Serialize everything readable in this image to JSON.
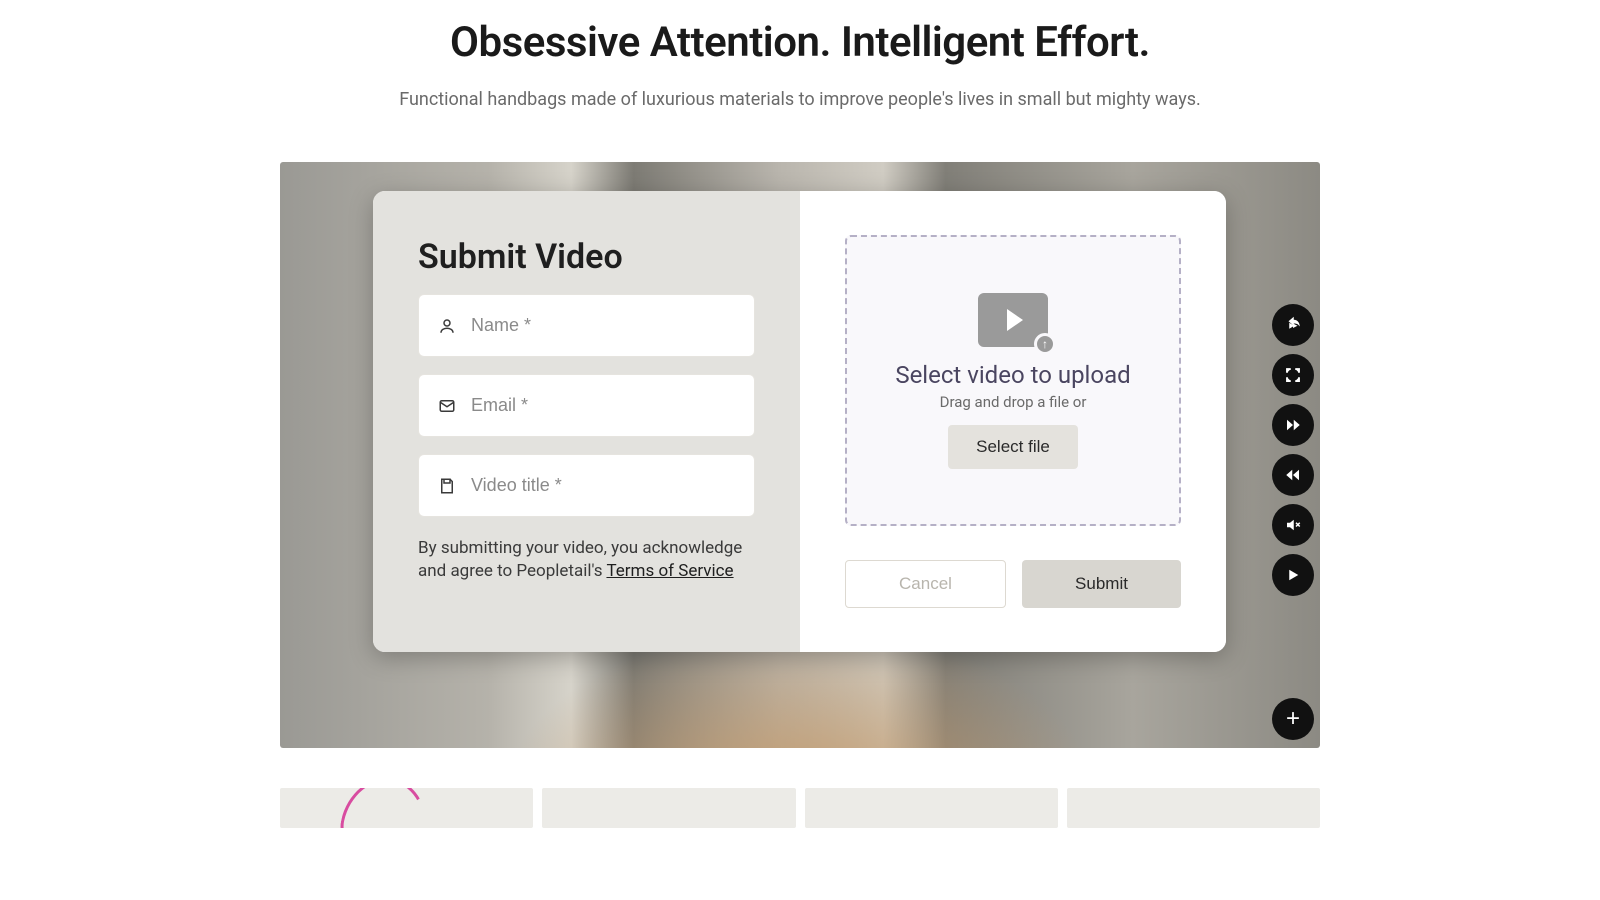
{
  "header": {
    "headline": "Obsessive Attention. Intelligent Effort.",
    "subheadline": "Functional handbags made of luxurious materials to improve people's lives in small but mighty ways."
  },
  "modal": {
    "title": "Submit Video",
    "name_placeholder": "Name *",
    "email_placeholder": "Email *",
    "title_placeholder": "Video title *",
    "legal_prefix": "By submitting your video, you acknowledge and agree to Peopletail's ",
    "legal_link": "Terms of Service",
    "dropzone": {
      "title": "Select video to upload",
      "subtitle": "Drag and drop a file or",
      "button": "Select file"
    },
    "cancel": "Cancel",
    "submit": "Submit"
  },
  "controls": {
    "share": "share",
    "fullscreen": "fullscreen",
    "forward": "fast-forward",
    "rewind": "rewind",
    "mute": "mute",
    "play": "play",
    "plus": "+"
  }
}
